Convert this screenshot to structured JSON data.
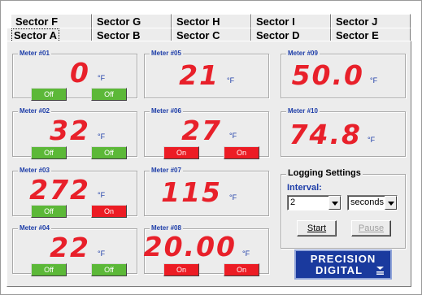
{
  "tabs": {
    "back_row": [
      "Sector F",
      "Sector G",
      "Sector H",
      "Sector I",
      "Sector J"
    ],
    "front_row": [
      "Sector A",
      "Sector B",
      "Sector C",
      "Sector D",
      "Sector E"
    ],
    "selected": "Sector A"
  },
  "meters": [
    {
      "title": "Meter #01",
      "value": "0",
      "unit": "°F",
      "relays": [
        "Off",
        "Off"
      ]
    },
    {
      "title": "Meter #02",
      "value": "32",
      "unit": "°F",
      "relays": [
        "Off",
        "Off"
      ]
    },
    {
      "title": "Meter #03",
      "value": "272",
      "unit": "°F",
      "relays": [
        "Off",
        "On"
      ]
    },
    {
      "title": "Meter #04",
      "value": "22",
      "unit": "°F",
      "relays": [
        "Off",
        "Off"
      ]
    },
    {
      "title": "Meter #05",
      "value": "21",
      "unit": "°F",
      "relays": []
    },
    {
      "title": "Meter #06",
      "value": "27",
      "unit": "°F",
      "relays": [
        "On",
        "On"
      ]
    },
    {
      "title": "Meter #07",
      "value": "115",
      "unit": "°F",
      "relays": []
    },
    {
      "title": "Meter #08",
      "value": "20.00",
      "unit": "°F",
      "relays": [
        "On",
        "On"
      ]
    },
    {
      "title": "Meter #09",
      "value": "50.0",
      "unit": "°F",
      "relays": []
    },
    {
      "title": "Meter #10",
      "value": "74.8",
      "unit": "°F",
      "relays": []
    }
  ],
  "logging": {
    "title": "Logging Settings",
    "interval_label": "Interval:",
    "interval_value": "2",
    "unit_value": "seconds",
    "start_label": "Start",
    "pause_label": "Pause"
  },
  "logo": {
    "line1": "PRECISION",
    "line2": "DIGITAL"
  },
  "colors": {
    "reading": "#e8202a",
    "label_blue": "#1d3da8",
    "relay_off": "#5cb838",
    "relay_on": "#ec1c24",
    "logo_bg": "#1a3a9e"
  }
}
